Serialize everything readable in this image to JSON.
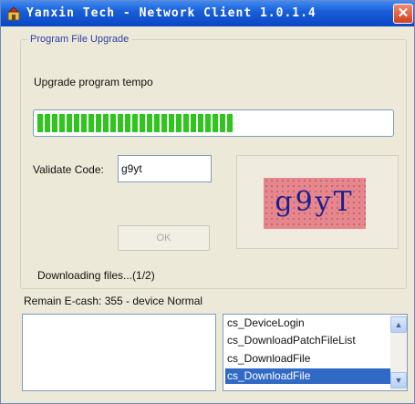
{
  "window": {
    "title": "Yanxin Tech - Network Client 1.0.1.4",
    "close_glyph": "✕"
  },
  "upgrade_group": {
    "legend": "Program File Upgrade",
    "label": "Upgrade program tempo",
    "progress_percent": 56
  },
  "validate": {
    "label": "Validate Code:",
    "value": "g9yt",
    "captcha_text": "g9yT"
  },
  "ok_button": {
    "label": "OK",
    "enabled": false
  },
  "status": {
    "downloading": "Downloading files...(1/2)",
    "remain": "Remain E-cash: 355 - device Normal"
  },
  "log_list": {
    "items": [
      "cs_DeviceLogin",
      "cs_DownloadPatchFileList",
      "cs_DownloadFile",
      "cs_DownloadFile"
    ],
    "selected_index": 3
  },
  "icons": {
    "app": "app-icon",
    "scroll_up": "chevron-up-icon",
    "scroll_down": "chevron-down-icon"
  },
  "colors": {
    "titlebar": "#0a46c4",
    "progress": "#2ec51c",
    "selection": "#316ac5",
    "captcha_bg": "#e7868c"
  }
}
